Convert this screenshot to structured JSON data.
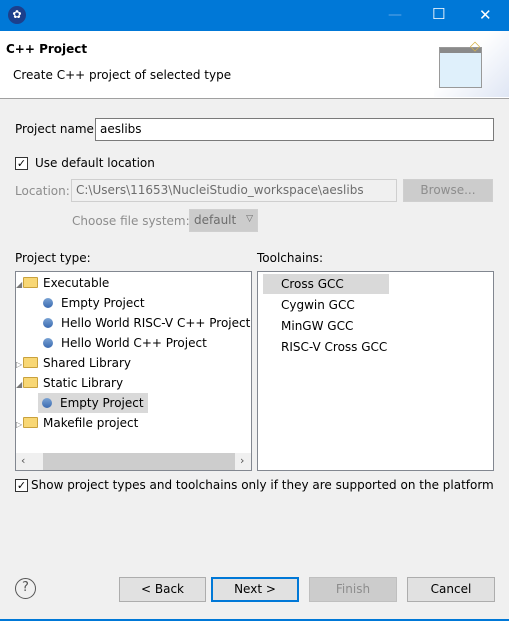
{
  "window": {
    "minimize": "—",
    "maximize": "☐",
    "close": "✕"
  },
  "header": {
    "title": "C++ Project",
    "subtitle": "Create C++ project of selected type"
  },
  "project_name": {
    "label": "Project name:",
    "value": "aeslibs"
  },
  "default_location": {
    "label": "Use default location",
    "checked": true
  },
  "location": {
    "label": "Location:",
    "value": "C:\\Users\\11653\\NucleiStudio_workspace\\aeslibs",
    "browse": "Browse..."
  },
  "file_system": {
    "label": "Choose file system:",
    "value": "default"
  },
  "project_type": {
    "label": "Project type:",
    "items": [
      {
        "label": "Executable",
        "kind": "folder",
        "expanded": true
      },
      {
        "label": "Empty Project",
        "kind": "item"
      },
      {
        "label": "Hello World RISC-V C++ Project",
        "kind": "item"
      },
      {
        "label": "Hello World C++ Project",
        "kind": "item"
      },
      {
        "label": "Shared Library",
        "kind": "folder",
        "expanded": false
      },
      {
        "label": "Static Library",
        "kind": "folder",
        "expanded": true
      },
      {
        "label": "Empty Project",
        "kind": "item",
        "selected": true
      },
      {
        "label": "Makefile project",
        "kind": "folder",
        "expanded": false
      }
    ]
  },
  "toolchains": {
    "label": "Toolchains:",
    "items": [
      "Cross GCC",
      "Cygwin GCC",
      "MinGW GCC",
      "RISC-V Cross GCC"
    ],
    "selected": "Cross GCC"
  },
  "show_supported": {
    "label": "Show project types and toolchains only if they are supported on the platform",
    "checked": true
  },
  "buttons": {
    "help": "?",
    "back": "< Back",
    "next": "Next >",
    "finish": "Finish",
    "cancel": "Cancel"
  },
  "colors": {
    "titlebar": "#0078d7",
    "selection": "#d9d9d9"
  }
}
